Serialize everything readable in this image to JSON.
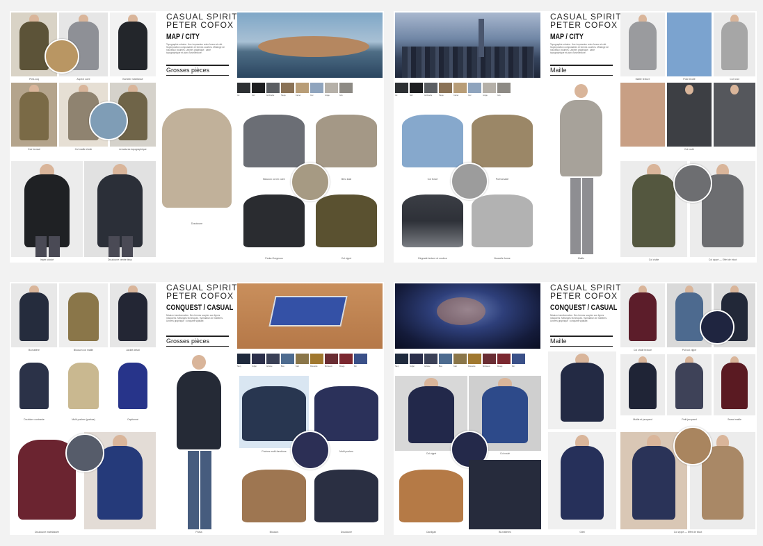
{
  "colors": {
    "background": "#f2f2f2",
    "page": "#ffffff",
    "title": "#222222",
    "rule": "#222222"
  },
  "boards": {
    "top_left": {
      "brand_line1": "CASUAL SPIRIT",
      "brand_line2": "PETER COFOX",
      "theme": "MAP / CITY",
      "blurb": "Topographie urbaine. Une impression entre freeze et cité. Superposition composables et formes courbes. Mélange de nouveaux volumes. Univers graphique : carte topographique et plan d'architecture.",
      "section": "Grosses pièces",
      "captions": [
        "Pied-coq",
        "Aspect cuire",
        "Bomber matelassé",
        "Cuir brossé",
        "Col maille étoile",
        "Armatures topographique",
        "Imper-clouté",
        "Doudoune ventre tissu",
        "Doudoune",
        "Blouson col en cuire",
        "Bleu kaki",
        "Parka Gorgeous",
        "Col zippé"
      ],
      "swatches": [
        "#2d3033",
        "#1d1e20",
        "#5b5e62",
        "#8a7256",
        "#b89d77",
        "#8fa4bd",
        "#b5b0a8",
        "#8d8a84"
      ],
      "swatch_labels": [
        "Ink",
        "Noir",
        "Anthracite",
        "Taupe",
        "Camel",
        "Ciel",
        "Grège",
        "Gris"
      ]
    },
    "top_right": {
      "brand_line1": "CASUAL SPIRIT",
      "brand_line2": "PETER COFOX",
      "theme": "MAP / CITY",
      "blurb": "Topographie urbaine. Une impression entre freeze et cité. Superposition composables et formes courbes. Mélange de nouveaux volumes. Univers graphique : carte topographique et plan d'architecture.",
      "section": "Maille",
      "captions": [
        "Maille texture",
        "Polo tricoté",
        "Col rond",
        "Col foncé",
        "Pull torsadé",
        "Dégradé texture et couleur",
        "Nouvelle forme",
        "Maille",
        "Col roulé",
        "Col châle",
        "Col zippé — Effet de tricot"
      ],
      "swatches": [
        "#2d3033",
        "#1d1e20",
        "#5b5e62",
        "#8a7256",
        "#b89d77",
        "#8fa4bd",
        "#b5b0a8",
        "#8d8a84"
      ],
      "swatch_labels": [
        "Ink",
        "Noir",
        "Anthracite",
        "Taupe",
        "Camel",
        "Ciel",
        "Grège",
        "Gris"
      ]
    },
    "bottom_left": {
      "brand_line1": "CASUAL SPIRIT",
      "brand_line2": "PETER COFOX",
      "theme": "CONQUEST / CASUAL",
      "blurb": "Mission transformation. Des formes souples aux lignes marquées. Mélanges techniques, hybridation de matières. Univers graphique : conquête spatiale.",
      "section": "Grosses pièces",
      "captions": [
        "Bi-matière",
        "Blouson col maille",
        "Jacket détail",
        "Doublure contraste",
        "Multi poches (parkas)",
        "Capitonné",
        "Doudoune matelassée",
        "Parka",
        "Poches multi-fonctions",
        "Multi poches",
        "Blouson",
        "Doudoune",
        "Blouson"
      ],
      "swatches": [
        "#1f2a3d",
        "#2b2f4a",
        "#3a4056",
        "#4d6b8f",
        "#8a7649",
        "#a0782f",
        "#6a2d33",
        "#7b2830",
        "#3a5088"
      ],
      "swatch_labels": [
        "Navy",
        "Indigo",
        "Ardoise",
        "Bleu",
        "Kaki",
        "Moutarde",
        "Bordeaux",
        "Rouge",
        "Roi"
      ]
    },
    "bottom_right": {
      "brand_line1": "CASUAL SPIRIT",
      "brand_line2": "PETER COFOX",
      "theme": "CONQUEST / CASUAL",
      "blurb": "Mission transformation. Des formes souples aux lignes marquées. Mélanges techniques, hybridation de matières. Univers graphique : conquête spatiale.",
      "section": "Maille",
      "captions": [
        "Col châle texture",
        "Pull col zippé",
        "Maille et jacquard",
        "Petit jacquard",
        "Sweat maille",
        "Col zippé",
        "Gilet",
        "Col roulé",
        "Cardigan",
        "Bi-matières",
        "Col zippé — Effet de tricot"
      ],
      "swatches": [
        "#1f2a3d",
        "#2b2f4a",
        "#3a4056",
        "#4d6b8f",
        "#8a7649",
        "#a0782f",
        "#6a2d33",
        "#7b2830",
        "#3a5088"
      ],
      "swatch_labels": [
        "Navy",
        "Indigo",
        "Ardoise",
        "Bleu",
        "Kaki",
        "Moutarde",
        "Bordeaux",
        "Rouge",
        "Roi"
      ]
    }
  }
}
